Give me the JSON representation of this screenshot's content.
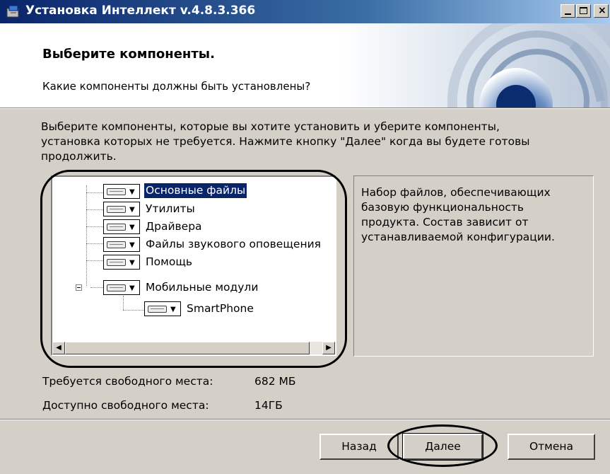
{
  "window": {
    "title": "Установка Интеллект v.4.8.3.366",
    "controls": {
      "minimize": "_",
      "maximize": "□",
      "close": "X"
    }
  },
  "header": {
    "title": "Выберите компоненты.",
    "subtitle": "Какие компоненты должны быть установлены?"
  },
  "instructions": "Выберите компоненты, которые вы хотите установить и уберите компоненты, установка которых не требуется. Нажмите кнопку \"Далее\" когда вы будете готовы продолжить.",
  "components": [
    {
      "label": "Основные файлы",
      "selected": true,
      "level": 0
    },
    {
      "label": "Утилиты",
      "selected": false,
      "level": 0
    },
    {
      "label": "Драйвера",
      "selected": false,
      "level": 0
    },
    {
      "label": "Файлы звукового оповещения",
      "selected": false,
      "level": 0
    },
    {
      "label": "Помощь",
      "selected": false,
      "level": 0
    },
    {
      "label": "Мобильные модули",
      "selected": false,
      "level": 0,
      "expanded": true
    },
    {
      "label": "SmartPhone",
      "selected": false,
      "level": 1
    }
  ],
  "description": "Набор файлов, обеспечивающих базовую функциональность продукта. Состав зависит от устанавливаемой конфигурации.",
  "space": {
    "required_label": "Требуется свободного места:",
    "required_value": "682 МБ",
    "available_label": "Доступно свободного места:",
    "available_value": "14ГБ"
  },
  "buttons": {
    "back": "Назад",
    "next": "Далее",
    "cancel": "Отмена"
  },
  "colors": {
    "titlebar_start": "#0a246a",
    "titlebar_end": "#a6caf0",
    "selection": "#0a246a",
    "dialog_bg": "#d4d0c8"
  },
  "icons": {
    "app": "installer-icon",
    "component": "hard-drive-icon",
    "dropdown": "triangle-down-icon"
  }
}
